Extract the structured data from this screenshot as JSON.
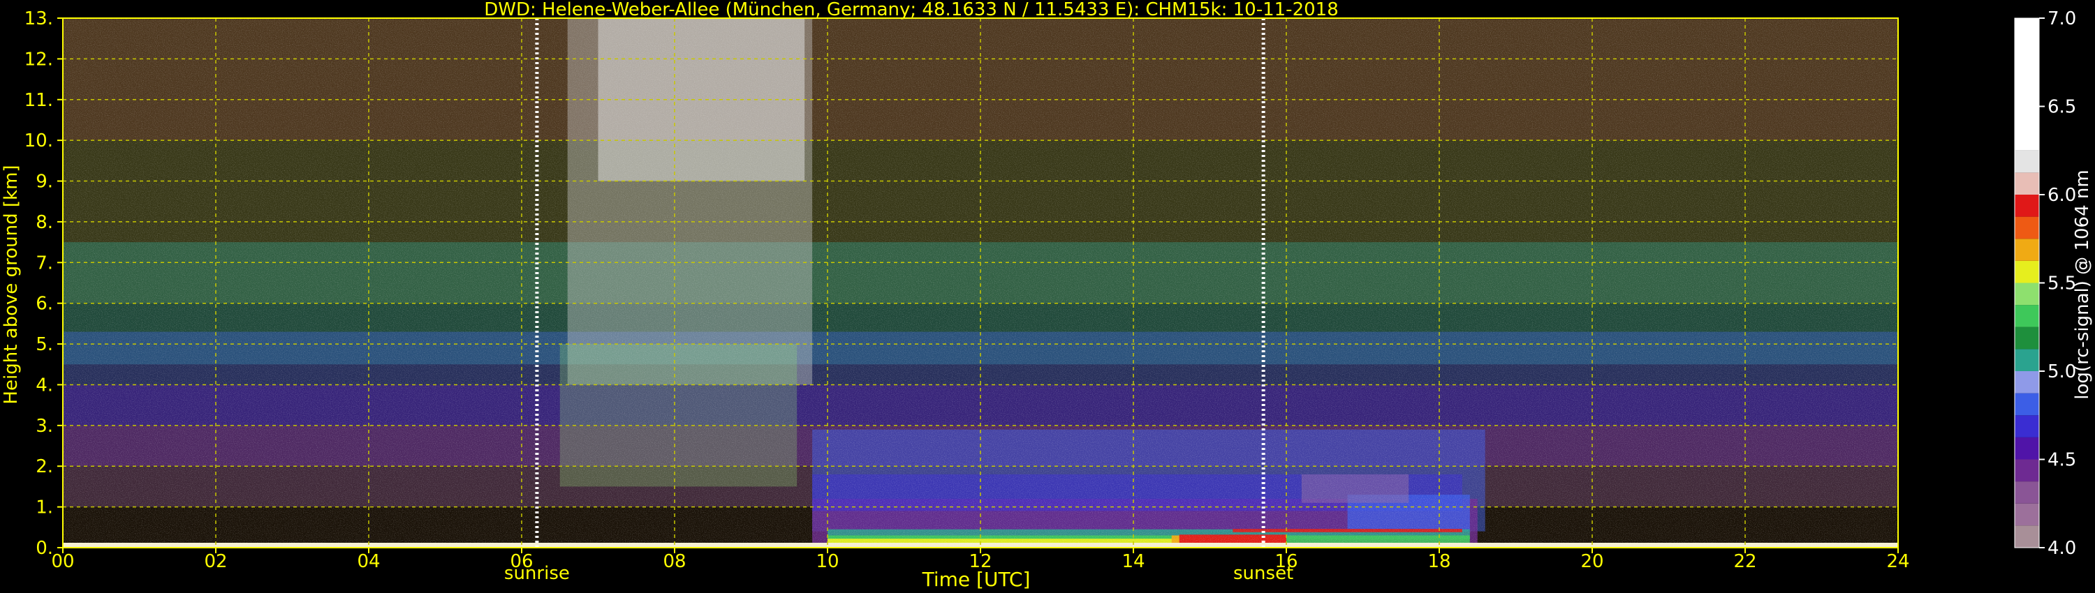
{
  "colors": {
    "background": "#000000",
    "axis_text": "#ffff00",
    "grid": "#c8c800",
    "colorbar_text": "#ffffff",
    "event_line": "#ffffff"
  },
  "chart_data": {
    "type": "heatmap",
    "title": "DWD: Helene-Weber-Allee (München, Germany; 48.1633 N / 11.5433 E):    CHM15k: 10-11-2018",
    "xlabel": "Time [UTC]",
    "ylabel": "Height above ground [km]",
    "xlim": [
      0,
      24
    ],
    "ylim": [
      0,
      13
    ],
    "x_ticks": [
      0,
      2,
      4,
      6,
      8,
      10,
      12,
      14,
      16,
      18,
      20,
      22,
      24
    ],
    "x_tick_labels": [
      "00",
      "02",
      "04",
      "06",
      "08",
      "10",
      "12",
      "14",
      "16",
      "18",
      "20",
      "22",
      "24"
    ],
    "y_ticks": [
      0,
      1,
      2,
      3,
      4,
      5,
      6,
      7,
      8,
      9,
      10,
      11,
      12,
      13
    ],
    "y_tick_labels": [
      "0.",
      "1.",
      "2.",
      "3.",
      "4.",
      "5.",
      "6.",
      "7.",
      "8.",
      "9.",
      "10.",
      "11.",
      "12.",
      "13."
    ],
    "grid": true,
    "events": [
      {
        "label": "sunrise",
        "time_utc": 6.2
      },
      {
        "label": "sunset",
        "time_utc": 15.7
      }
    ],
    "colorbar": {
      "label": "log(rc-signal) @ 1064 nm",
      "range": [
        4.0,
        7.0
      ],
      "ticks": [
        4.0,
        4.5,
        5.0,
        5.5,
        6.0,
        6.5,
        7.0
      ],
      "tick_labels": [
        "4.0",
        "4.5",
        "5.0",
        "5.5",
        "6.0",
        "6.5",
        "7.0"
      ],
      "bands": [
        {
          "from": 4.0,
          "to": 4.125,
          "color": "#a88f98"
        },
        {
          "from": 4.125,
          "to": 4.25,
          "color": "#9c709b"
        },
        {
          "from": 4.25,
          "to": 4.375,
          "color": "#8a5596"
        },
        {
          "from": 4.375,
          "to": 4.5,
          "color": "#6e2a92"
        },
        {
          "from": 4.5,
          "to": 4.625,
          "color": "#5014a8"
        },
        {
          "from": 4.625,
          "to": 4.75,
          "color": "#3a2dd2"
        },
        {
          "from": 4.75,
          "to": 4.875,
          "color": "#3c5ee6"
        },
        {
          "from": 4.875,
          "to": 5.0,
          "color": "#8f9ae8"
        },
        {
          "from": 5.0,
          "to": 5.125,
          "color": "#2aa38f"
        },
        {
          "from": 5.125,
          "to": 5.25,
          "color": "#1e8f3c"
        },
        {
          "from": 5.25,
          "to": 5.375,
          "color": "#3ec85a"
        },
        {
          "from": 5.375,
          "to": 5.5,
          "color": "#8ee06e"
        },
        {
          "from": 5.5,
          "to": 5.625,
          "color": "#e6ee1e"
        },
        {
          "from": 5.625,
          "to": 5.75,
          "color": "#f0aa14"
        },
        {
          "from": 5.75,
          "to": 5.875,
          "color": "#ee5a14"
        },
        {
          "from": 5.875,
          "to": 6.0,
          "color": "#e01818"
        },
        {
          "from": 6.0,
          "to": 6.125,
          "color": "#e8beb6"
        },
        {
          "from": 6.125,
          "to": 6.25,
          "color": "#e4e4e4"
        },
        {
          "from": 6.25,
          "to": 7.0,
          "color": "#ffffff"
        }
      ]
    },
    "regions": [
      {
        "color": "#7a8a3a",
        "t0": 0,
        "t1": 24,
        "h0": 6.0,
        "h1": 13.0,
        "opacity": 0.32
      },
      {
        "color": "#6a3a2a",
        "t0": 0,
        "t1": 24,
        "h0": 10.0,
        "h1": 13.0,
        "opacity": 0.45
      },
      {
        "color": "#2aa38f",
        "t0": 0,
        "t1": 24,
        "h0": 4.5,
        "h1": 7.5,
        "opacity": 0.38
      },
      {
        "color": "#3c5ee6",
        "t0": 0,
        "t1": 24,
        "h0": 3.0,
        "h1": 5.3,
        "opacity": 0.38
      },
      {
        "color": "#5014a8",
        "t0": 0,
        "t1": 24,
        "h0": 2.0,
        "h1": 4.0,
        "opacity": 0.4
      },
      {
        "color": "#8a5596",
        "t0": 0,
        "t1": 24,
        "h0": 1.0,
        "h1": 3.0,
        "opacity": 0.35
      },
      {
        "color": "#c8c8c8",
        "t0": 6.6,
        "t1": 9.8,
        "h0": 4.0,
        "h1": 13.0,
        "opacity": 0.42
      },
      {
        "color": "#e4e4e4",
        "t0": 7.0,
        "t1": 9.7,
        "h0": 9.0,
        "h1": 13.0,
        "opacity": 0.5
      },
      {
        "color": "#8ee06e",
        "t0": 6.5,
        "t1": 9.6,
        "h0": 1.5,
        "h1": 5.0,
        "opacity": 0.28
      },
      {
        "color": "#3c5ee6",
        "t0": 9.8,
        "t1": 18.6,
        "h0": 0.4,
        "h1": 2.9,
        "opacity": 0.5
      },
      {
        "color": "#6e2a92",
        "t0": 9.8,
        "t1": 18.5,
        "h0": 0.1,
        "h1": 1.2,
        "opacity": 0.8
      },
      {
        "color": "#3a2dd2",
        "t0": 9.8,
        "t1": 18.3,
        "h0": 0.9,
        "h1": 1.8,
        "opacity": 0.55
      },
      {
        "color": "#3c5ee6",
        "t0": 16.8,
        "t1": 18.4,
        "h0": 0.4,
        "h1": 1.3,
        "opacity": 0.75
      },
      {
        "color": "#9c709b",
        "t0": 16.2,
        "t1": 17.6,
        "h0": 1.1,
        "h1": 1.8,
        "opacity": 0.45
      },
      {
        "color": "#2aa38f",
        "t0": 10.0,
        "t1": 18.4,
        "h0": 0.2,
        "h1": 0.45,
        "opacity": 0.85
      },
      {
        "color": "#3ec85a",
        "t0": 10.0,
        "t1": 18.4,
        "h0": 0.1,
        "h1": 0.3,
        "opacity": 0.9
      },
      {
        "color": "#e6ee1e",
        "t0": 10.0,
        "t1": 15.5,
        "h0": 0.05,
        "h1": 0.22,
        "opacity": 0.95
      },
      {
        "color": "#f0aa14",
        "t0": 14.5,
        "t1": 16.0,
        "h0": 0.1,
        "h1": 0.3,
        "opacity": 0.95
      },
      {
        "color": "#e01818",
        "t0": 14.6,
        "t1": 16.0,
        "h0": 0.12,
        "h1": 0.32,
        "opacity": 0.95
      },
      {
        "color": "#e01818",
        "t0": 15.3,
        "t1": 18.3,
        "h0": 0.38,
        "h1": 0.46,
        "opacity": 0.9
      },
      {
        "color": "#f5efd2",
        "t0": 0,
        "t1": 24,
        "h0": 0.0,
        "h1": 0.12,
        "opacity": 1.0
      }
    ]
  }
}
